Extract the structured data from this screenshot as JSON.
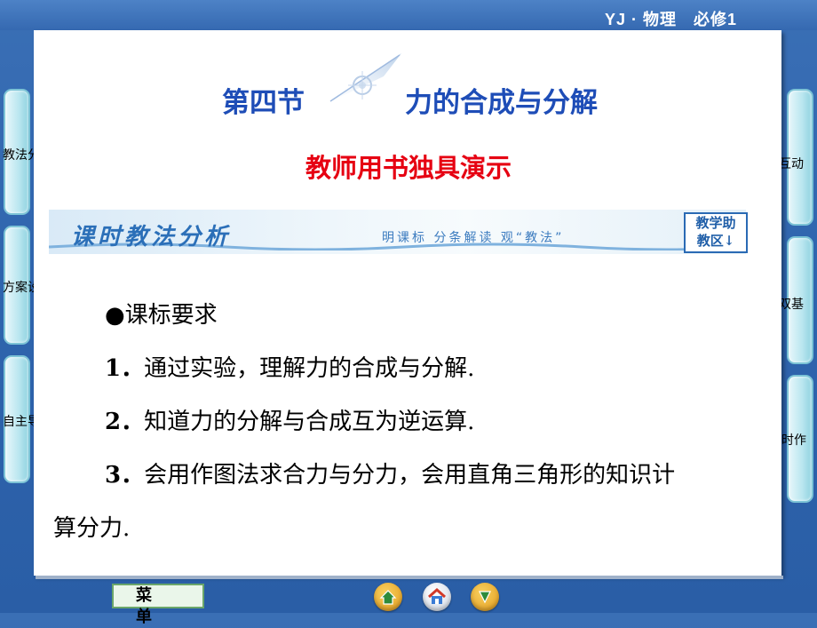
{
  "header": {
    "course": "YJ · 物理　必修1"
  },
  "left_nav": [
    {
      "label": "教法分析"
    },
    {
      "label": "方案设计"
    },
    {
      "label": "自主导学"
    }
  ],
  "right_nav": [
    {
      "label": "课堂互动"
    },
    {
      "label": "当堂双基"
    },
    {
      "label": "课时作"
    }
  ],
  "slide": {
    "section": "第四节",
    "title": "力的合成与分解",
    "subtitle": "教师用书独具演示",
    "banner": {
      "title": "课时教法分析",
      "slogan": "明课标 分条解读 观“教法”",
      "badge_line1": "教学助",
      "badge_line2": "教区↓"
    },
    "standards": {
      "heading": "●课标要求",
      "items": [
        {
          "num": "1．",
          "text": "通过实验，理解力的合成与分解."
        },
        {
          "num": "2．",
          "text": "知道力的分解与合成互为逆运算."
        },
        {
          "num": "3．",
          "text": "会用作图法求合力与分力，会用直角三角形的知识计",
          "cont": "算分力."
        }
      ]
    }
  },
  "footer": {
    "menu_label": "菜 单",
    "nav_icons": [
      "home-back-icon",
      "house-icon",
      "forward-icon"
    ]
  },
  "colors": {
    "title_blue": "#1e4db7",
    "subtitle_red": "#e60012",
    "frame_blue": "#2f65ae"
  }
}
